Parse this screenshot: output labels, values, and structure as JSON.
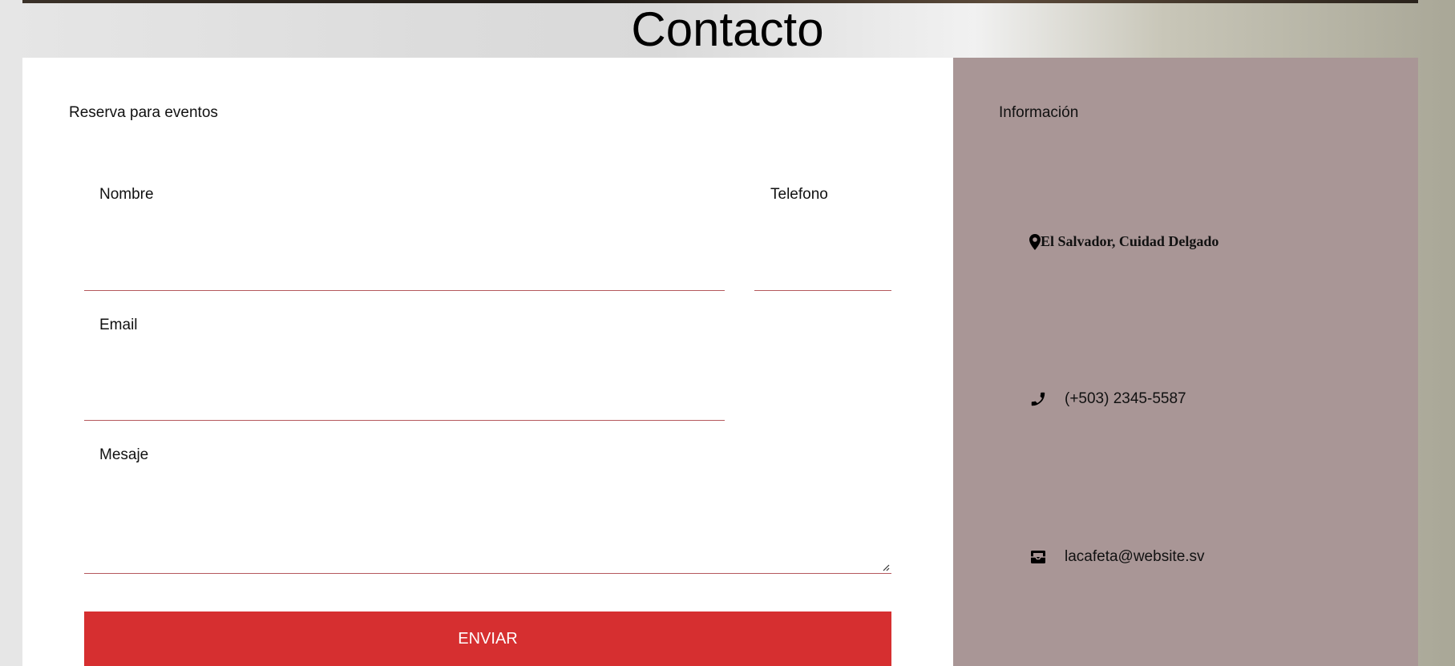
{
  "page": {
    "title": "Contacto"
  },
  "form": {
    "heading": "Reserva para eventos",
    "fields": {
      "name_label": "Nombre",
      "phone_label": "Telefono",
      "email_label": "Email",
      "message_label": "Mesaje"
    },
    "submit_label": "ENVIAR"
  },
  "info": {
    "heading": "Información",
    "address": "El Salvador, Cuidad Delgado",
    "phone": "(+503) 2345-5587",
    "email": "lacafeta@website.sv",
    "icons": {
      "address": "map-marker-icon",
      "phone": "phone-icon",
      "email": "envelope-open-icon"
    }
  },
  "colors": {
    "accent": "#d62f30",
    "field_underline": "#b5595d",
    "info_panel_bg": "#a99696",
    "form_panel_bg": "#ffffff"
  }
}
